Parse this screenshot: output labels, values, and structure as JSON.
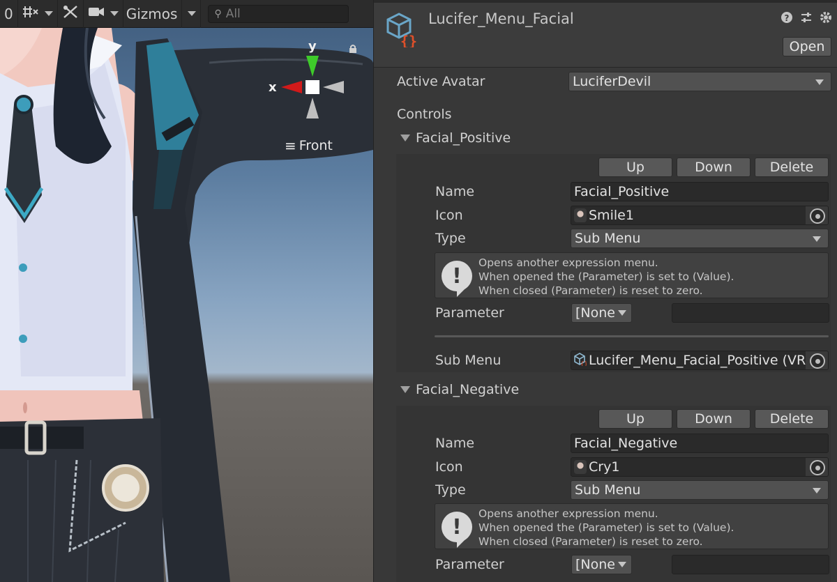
{
  "scene": {
    "toolbar": {
      "counter": "0",
      "gizmos_label": "Gizmos",
      "search_placeholder": "All"
    },
    "gizmo": {
      "x_label": "x",
      "y_label": "y",
      "view_label": "Front"
    }
  },
  "inspector": {
    "asset_title": "Lucifer_Menu_Facial",
    "open_label": "Open",
    "active_avatar_label": "Active Avatar",
    "active_avatar_value": "LuciferDevil",
    "controls_label": "Controls",
    "controls": [
      {
        "foldout": "Facial_Positive",
        "up_label": "Up",
        "down_label": "Down",
        "delete_label": "Delete",
        "name_label": "Name",
        "name_value": "Facial_Positive",
        "icon_label": "Icon",
        "icon_value": "Smile1",
        "type_label": "Type",
        "type_value": "Sub Menu",
        "help_line1": "Opens another expression menu.",
        "help_line2": "When opened the (Parameter) is set to (Value).",
        "help_line3": "When closed (Parameter) is reset to zero.",
        "parameter_label": "Parameter",
        "parameter_value": "[None",
        "submenu_label": "Sub Menu",
        "submenu_value": "Lucifer_Menu_Facial_Positive (VR"
      },
      {
        "foldout": "Facial_Negative",
        "up_label": "Up",
        "down_label": "Down",
        "delete_label": "Delete",
        "name_label": "Name",
        "name_value": "Facial_Negative",
        "icon_label": "Icon",
        "icon_value": "Cry1",
        "type_label": "Type",
        "type_value": "Sub Menu",
        "help_line1": "Opens another expression menu.",
        "help_line2": "When opened the (Parameter) is set to (Value).",
        "help_line3": "When closed (Parameter) is reset to zero.",
        "parameter_label": "Parameter",
        "parameter_value": "[None"
      }
    ]
  },
  "colors": {
    "gizmo_x": "#d11a1a",
    "gizmo_y": "#3ecb2a",
    "icon_cube": "#6aa6c8",
    "icon_braces": "#e0502a"
  }
}
